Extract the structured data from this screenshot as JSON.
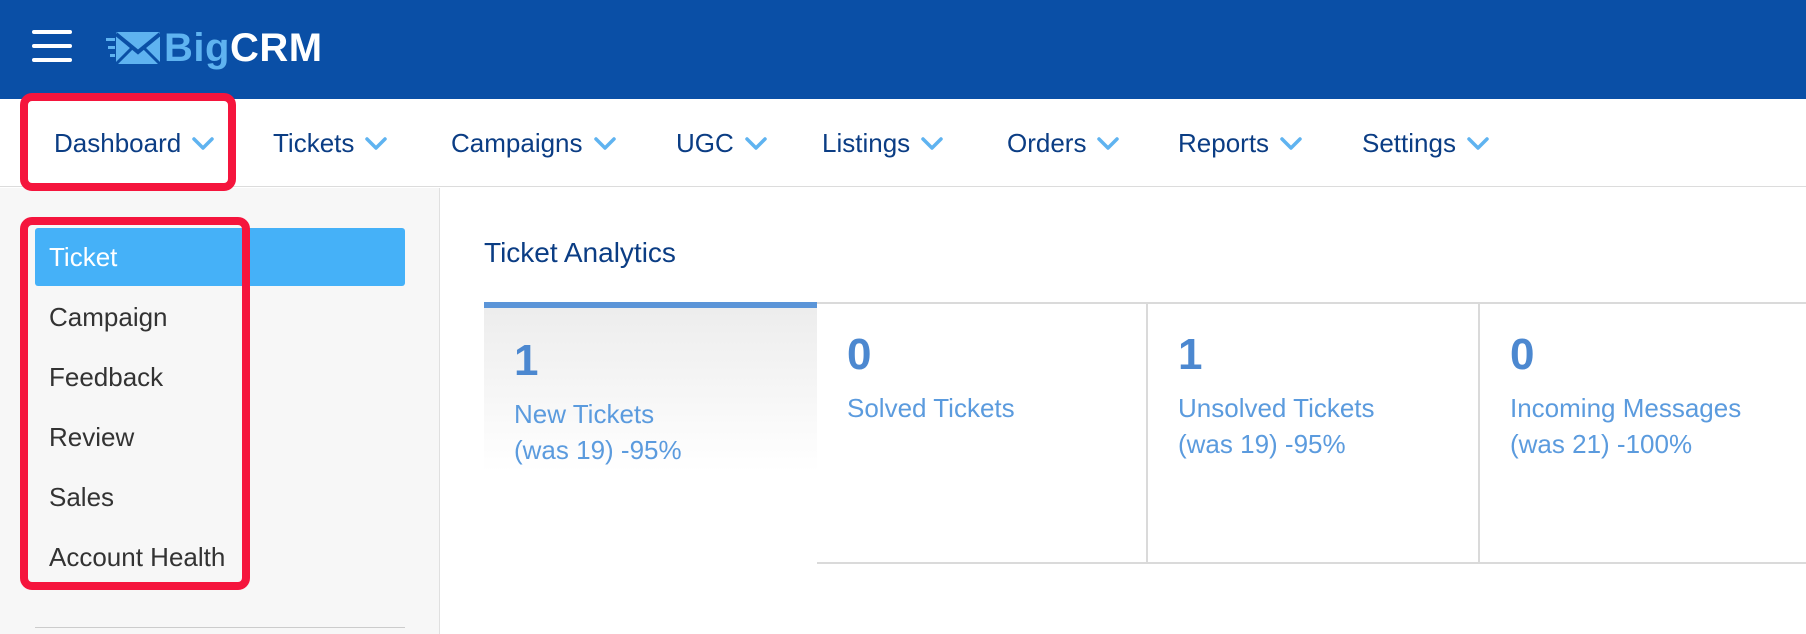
{
  "header": {
    "logo_big": "Big",
    "logo_crm": "CRM",
    "brand_color": "#0a4fa6"
  },
  "nav": {
    "items": [
      {
        "label": "Dashboard"
      },
      {
        "label": "Tickets"
      },
      {
        "label": "Campaigns"
      },
      {
        "label": "UGC"
      },
      {
        "label": "Listings"
      },
      {
        "label": "Orders"
      },
      {
        "label": "Reports"
      },
      {
        "label": "Settings"
      }
    ]
  },
  "sidebar": {
    "items": [
      {
        "label": "Ticket",
        "active": true
      },
      {
        "label": "Campaign"
      },
      {
        "label": "Feedback"
      },
      {
        "label": "Review"
      },
      {
        "label": "Sales"
      },
      {
        "label": "Account Health"
      }
    ],
    "active_color": "#45b1f8"
  },
  "main": {
    "title": "Ticket Analytics",
    "cards": [
      {
        "value": "1",
        "label": "New Tickets",
        "change": "(was 19) -95%"
      },
      {
        "value": "0",
        "label": "Solved Tickets",
        "change": ""
      },
      {
        "value": "1",
        "label": "Unsolved Tickets",
        "change": "(was 19) -95%"
      },
      {
        "value": "0",
        "label": "Incoming Messages",
        "change": "(was 21) -100%"
      }
    ]
  },
  "highlight_color": "#f5153d",
  "icons": {
    "menu": "hamburger-menu-icon",
    "logo": "envelope-logo-icon",
    "dropdown": "chevron-down-icon"
  }
}
